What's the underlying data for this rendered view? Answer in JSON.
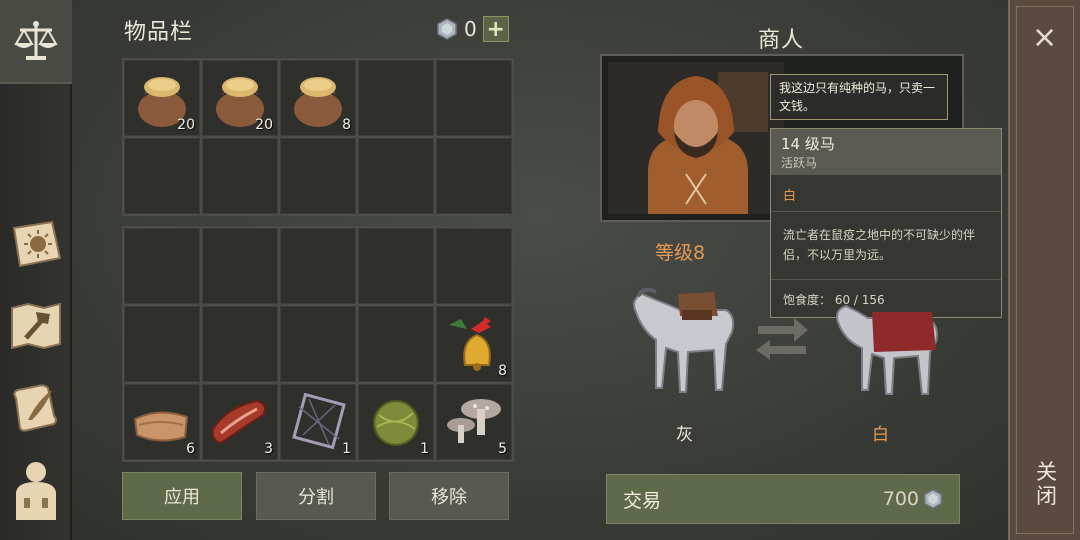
{
  "inventory": {
    "title": "物品栏",
    "currency_value": "0",
    "plus_label": "+",
    "top_grid": [
      {
        "item": "grain-sack",
        "count": "20"
      },
      {
        "item": "grain-sack",
        "count": "20"
      },
      {
        "item": "grain-sack",
        "count": "8"
      },
      {
        "item": "",
        "count": ""
      },
      {
        "item": "",
        "count": ""
      },
      {
        "item": "",
        "count": ""
      },
      {
        "item": "",
        "count": ""
      },
      {
        "item": "",
        "count": ""
      },
      {
        "item": "",
        "count": ""
      },
      {
        "item": "",
        "count": ""
      }
    ],
    "bottom_grid": [
      {
        "item": "",
        "count": ""
      },
      {
        "item": "",
        "count": ""
      },
      {
        "item": "",
        "count": ""
      },
      {
        "item": "",
        "count": ""
      },
      {
        "item": "",
        "count": ""
      },
      {
        "item": "",
        "count": ""
      },
      {
        "item": "",
        "count": ""
      },
      {
        "item": "",
        "count": ""
      },
      {
        "item": "",
        "count": ""
      },
      {
        "item": "bell",
        "count": "8"
      },
      {
        "item": "leather",
        "count": "6"
      },
      {
        "item": "raw-meat",
        "count": "3"
      },
      {
        "item": "net",
        "count": "1"
      },
      {
        "item": "hay-ball",
        "count": "1"
      },
      {
        "item": "mushrooms",
        "count": "5"
      }
    ],
    "buttons": {
      "apply": "应用",
      "split": "分割",
      "remove": "移除"
    }
  },
  "merchant": {
    "title": "商人",
    "speech": "我这边只有纯种的马，只卖一文钱。",
    "tooltip": {
      "name": "14 级马",
      "subtitle": "活跃马",
      "rarity": "白",
      "description": "流亡者在鼠疫之地中的不可缺少的伴侣，不以万里为远。",
      "satiety": "饱食度： 60 / 156"
    },
    "level": "等级8",
    "left_horse_label": "灰",
    "right_horse_label": "白",
    "trade_label": "交易",
    "trade_price": "700"
  },
  "close": {
    "x": "×",
    "label": "关闭"
  },
  "colors": {
    "accent_orange": "#e59a55",
    "trade_green": "#5f6a4b"
  },
  "icons": {
    "sidebar": [
      "scales-icon",
      "journal-sun-icon",
      "map-hammer-icon",
      "scroll-quill-icon",
      "character-icon"
    ]
  }
}
